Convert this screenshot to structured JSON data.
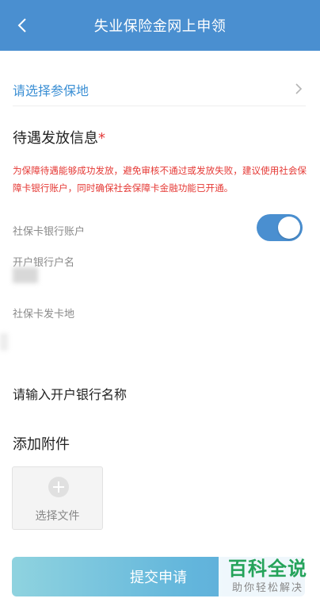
{
  "header": {
    "title": "失业保险金网上申领",
    "back_icon": "chevron-left-icon"
  },
  "region": {
    "label": "请选择参保地",
    "chevron_icon": "chevron-right-icon"
  },
  "benefit_section": {
    "title": "待遇发放信息",
    "required_mark": "*",
    "notice": "为保障待遇能够成功发放，避免审核不通过或发放失败，建议使用社会保障卡银行账户，同时确保社会保障卡金融功能已开通。"
  },
  "fields": {
    "ss_card_account_label": "社保卡银行账户",
    "ss_card_account_on": true,
    "account_holder_label": "开户银行户名",
    "card_issuing_place_label": "社保卡发卡地",
    "bank_name_placeholder": "请输入开户银行名称"
  },
  "attachments": {
    "title": "添加附件",
    "choose_file_label": "选择文件"
  },
  "submit_label": "提交申请",
  "watermark": {
    "main": "百科全说",
    "sub": "助你轻松解决"
  },
  "colors": {
    "header": "#4a8fd0",
    "link": "#3b8fd4",
    "warning": "#e53935",
    "toggle_on": "#4a8fd0",
    "watermark_green": "#25a35a"
  }
}
